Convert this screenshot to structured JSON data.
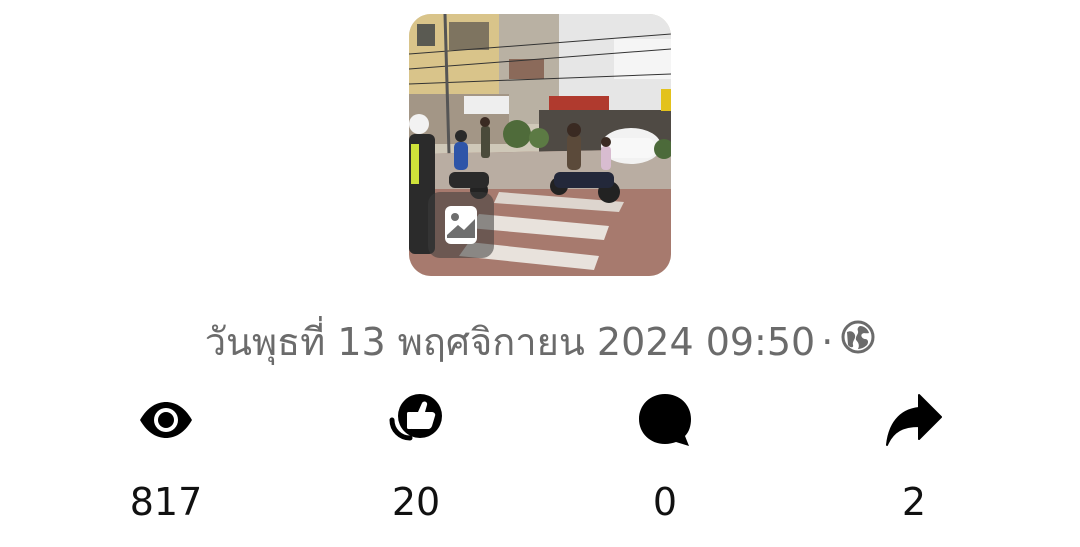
{
  "post": {
    "photo_label": "",
    "date_text": "วันพุธที่ 13 พฤศจิกายน  2024 09:50",
    "separator": "·",
    "privacy_icon": "globe-icon"
  },
  "stats": [
    {
      "icon": "eye-icon",
      "count": "817"
    },
    {
      "icon": "thumbs-up-icon",
      "count": "20"
    },
    {
      "icon": "comment-icon",
      "count": "0"
    },
    {
      "icon": "share-icon",
      "count": "2"
    }
  ],
  "colors": {
    "text_secondary": "#6b6b6b",
    "text_primary": "#111111",
    "icon": "#000000"
  }
}
